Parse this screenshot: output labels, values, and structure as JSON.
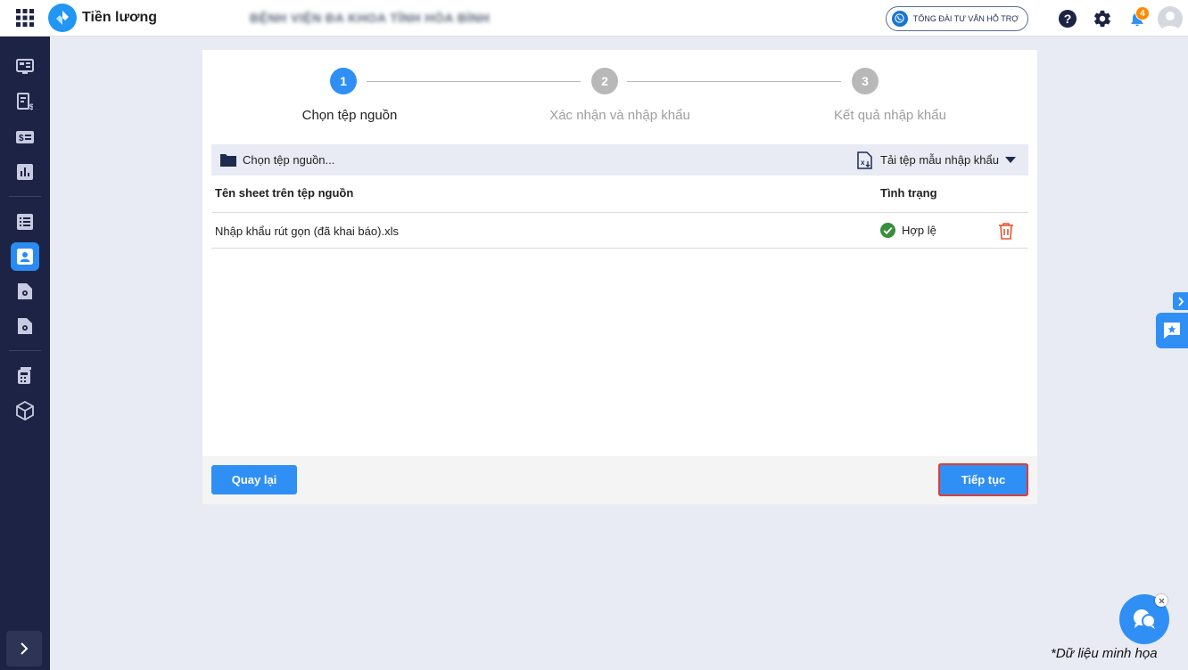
{
  "header": {
    "app_title": "Tiền lương",
    "org_name": "BỆNH VIỆN ĐA KHOA TỈNH HÒA BÌNH",
    "hotline_label": "TỔNG ĐÀI TƯ VẤN HỖ TRỢ",
    "notification_count": "4"
  },
  "stepper": {
    "steps": [
      {
        "number": "1",
        "label": "Chọn tệp nguồn",
        "state": "active"
      },
      {
        "number": "2",
        "label": "Xác nhận và nhập khẩu",
        "state": "pending"
      },
      {
        "number": "3",
        "label": "Kết quả nhập khẩu",
        "state": "pending"
      }
    ]
  },
  "toolbar": {
    "choose_file_label": "Chọn tệp nguồn...",
    "download_template_label": "Tải tệp mẫu nhập khẩu"
  },
  "table": {
    "columns": [
      "Tên sheet trên tệp nguồn",
      "Tình trạng"
    ],
    "rows": [
      {
        "file_name": "Nhập khẩu rút gọn (đã khai báo).xls",
        "status": "Hợp lệ"
      }
    ]
  },
  "footer": {
    "back_label": "Quay lại",
    "next_label": "Tiếp tục"
  },
  "watermark": "*Dữ liệu minh họa",
  "colors": {
    "accent": "#2f8ff5",
    "sidebar": "#1d2345",
    "success": "#388e3c",
    "danger": "#e8552f",
    "step_inactive": "#b8b8b8"
  }
}
